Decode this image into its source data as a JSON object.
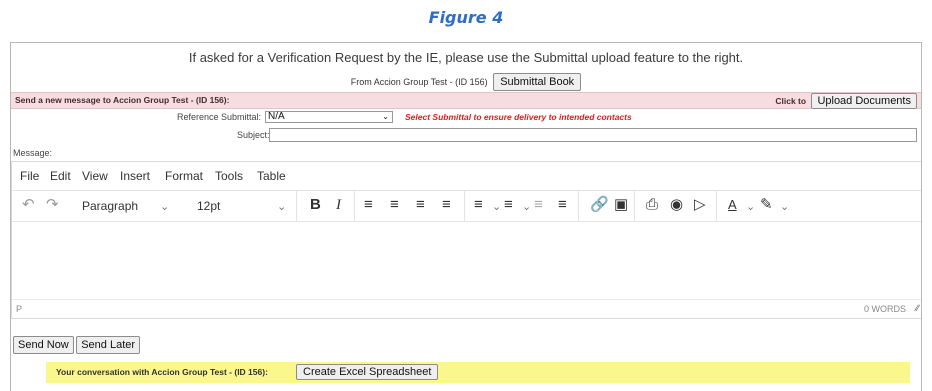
{
  "caption": "Figure 4",
  "notice": "If asked for a Verification Request by the IE, please use the Submittal upload feature to the right.",
  "from": {
    "text": "From Accion Group Test - (ID 156)",
    "button": "Submittal Book"
  },
  "compose_bar": {
    "title": "Send a new message to Accion Group Test - (ID 156):",
    "click_to": "Click to",
    "upload_button": "Upload Documents"
  },
  "reference": {
    "label": "Reference Submittal:",
    "value": "N/A",
    "warning": "Select Submittal to ensure delivery to intended contacts"
  },
  "subject": {
    "label": "Subject:",
    "value": ""
  },
  "message_label": "Message:",
  "editor": {
    "menu": [
      "File",
      "Edit",
      "View",
      "Insert",
      "Format",
      "Tools",
      "Table"
    ],
    "block_format": "Paragraph",
    "font_size": "12pt",
    "status_path": "P",
    "word_count": "0 WORDS"
  },
  "actions": {
    "send_now": "Send Now",
    "send_later": "Send Later"
  },
  "conversation": {
    "text": "Your conversation with Accion Group Test - (ID 156):",
    "button": "Create Excel Spreadsheet"
  }
}
